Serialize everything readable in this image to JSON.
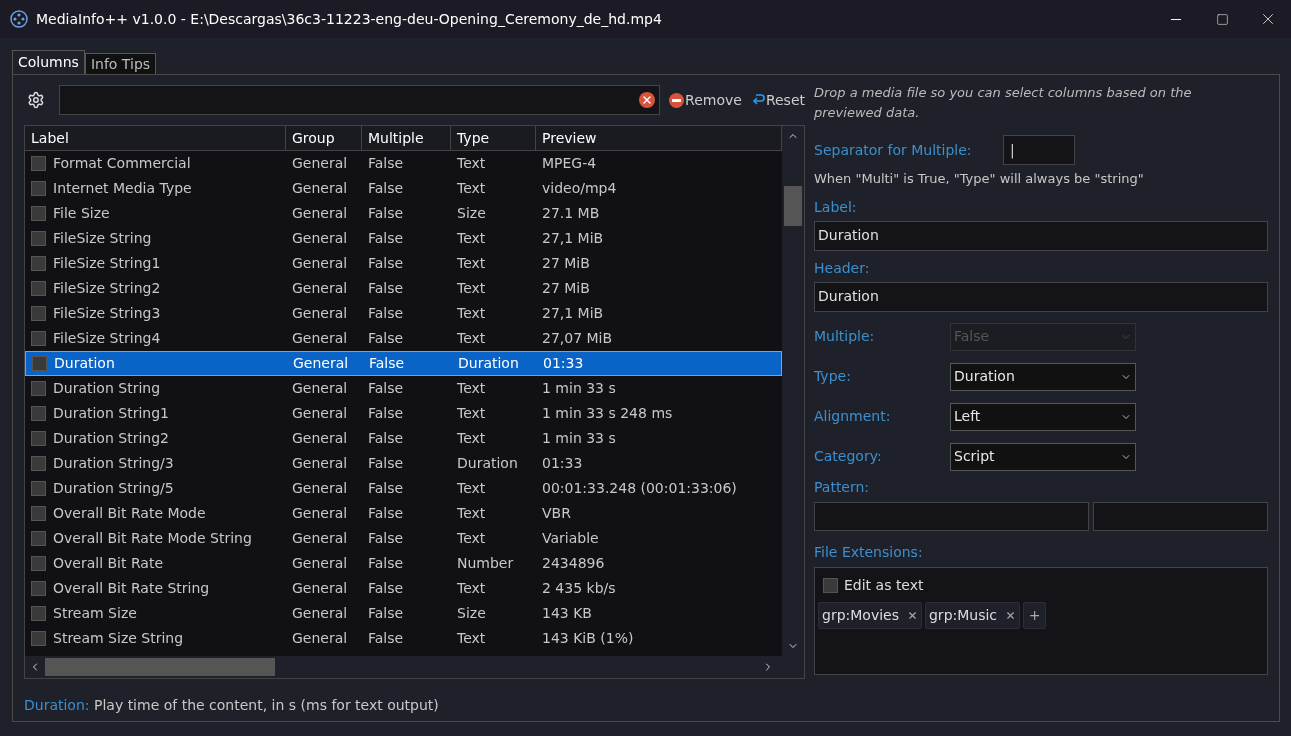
{
  "window": {
    "title": "MediaInfo++ v1.0.0 - E:\\Descargas\\36c3-11223-eng-deu-Opening_Ceremony_de_hd.mp4"
  },
  "tabs": [
    {
      "label": "Columns",
      "selected": true
    },
    {
      "label": "Info Tips",
      "selected": false
    }
  ],
  "toolbar": {
    "remove": "Remove",
    "reset": "Reset"
  },
  "table": {
    "columns": [
      "Label",
      "Group",
      "Multiple",
      "Type",
      "Preview"
    ],
    "rows": [
      {
        "label": "Format Commercial",
        "group": "General",
        "multiple": "False",
        "type": "Text",
        "preview": "MPEG-4",
        "checked": false,
        "selected": false
      },
      {
        "label": "Internet Media Type",
        "group": "General",
        "multiple": "False",
        "type": "Text",
        "preview": "video/mp4",
        "checked": false,
        "selected": false
      },
      {
        "label": "File Size",
        "group": "General",
        "multiple": "False",
        "type": "Size",
        "preview": "27.1 MB",
        "checked": false,
        "selected": false
      },
      {
        "label": "FileSize String",
        "group": "General",
        "multiple": "False",
        "type": "Text",
        "preview": "27,1 MiB",
        "checked": false,
        "selected": false
      },
      {
        "label": "FileSize String1",
        "group": "General",
        "multiple": "False",
        "type": "Text",
        "preview": "27 MiB",
        "checked": false,
        "selected": false
      },
      {
        "label": "FileSize String2",
        "group": "General",
        "multiple": "False",
        "type": "Text",
        "preview": "27 MiB",
        "checked": false,
        "selected": false
      },
      {
        "label": "FileSize String3",
        "group": "General",
        "multiple": "False",
        "type": "Text",
        "preview": "27,1 MiB",
        "checked": false,
        "selected": false
      },
      {
        "label": "FileSize String4",
        "group": "General",
        "multiple": "False",
        "type": "Text",
        "preview": "27,07 MiB",
        "checked": false,
        "selected": false
      },
      {
        "label": "Duration",
        "group": "General",
        "multiple": "False",
        "type": "Duration",
        "preview": "01:33",
        "checked": false,
        "selected": true
      },
      {
        "label": "Duration String",
        "group": "General",
        "multiple": "False",
        "type": "Text",
        "preview": "1 min 33 s",
        "checked": false,
        "selected": false
      },
      {
        "label": "Duration String1",
        "group": "General",
        "multiple": "False",
        "type": "Text",
        "preview": "1 min 33 s 248 ms",
        "checked": false,
        "selected": false
      },
      {
        "label": "Duration String2",
        "group": "General",
        "multiple": "False",
        "type": "Text",
        "preview": "1 min 33 s",
        "checked": false,
        "selected": false
      },
      {
        "label": "Duration String/3",
        "group": "General",
        "multiple": "False",
        "type": "Duration",
        "preview": "01:33",
        "checked": false,
        "selected": false
      },
      {
        "label": "Duration String/5",
        "group": "General",
        "multiple": "False",
        "type": "Text",
        "preview": "00:01:33.248 (00:01:33:06)",
        "checked": false,
        "selected": false
      },
      {
        "label": "Overall Bit Rate Mode",
        "group": "General",
        "multiple": "False",
        "type": "Text",
        "preview": "VBR",
        "checked": false,
        "selected": false
      },
      {
        "label": "Overall Bit Rate Mode String",
        "group": "General",
        "multiple": "False",
        "type": "Text",
        "preview": "Variable",
        "checked": false,
        "selected": false
      },
      {
        "label": "Overall Bit Rate",
        "group": "General",
        "multiple": "False",
        "type": "Number",
        "preview": "2434896",
        "checked": false,
        "selected": false
      },
      {
        "label": "Overall Bit Rate String",
        "group": "General",
        "multiple": "False",
        "type": "Text",
        "preview": "2 435 kb/s",
        "checked": false,
        "selected": false
      },
      {
        "label": "Stream Size",
        "group": "General",
        "multiple": "False",
        "type": "Size",
        "preview": "143 KB",
        "checked": false,
        "selected": false
      },
      {
        "label": "Stream Size String",
        "group": "General",
        "multiple": "False",
        "type": "Text",
        "preview": "143 KiB (1%)",
        "checked": false,
        "selected": false
      }
    ]
  },
  "status": {
    "label": "Duration:",
    "text": "Play time of the content, in s (ms for text output)"
  },
  "editor": {
    "hint": "Drop a media file so you can select columns based on the previewed data.",
    "separator_label": "Separator for Multiple:",
    "separator_value": "|",
    "note": "When \"Multi\" is True, \"Type\" will always be \"string\"",
    "label_label": "Label:",
    "label_value": "Duration",
    "header_label": "Header:",
    "header_value": "Duration",
    "selects": [
      {
        "label": "Multiple:",
        "value": "False",
        "disabled": true
      },
      {
        "label": "Type:",
        "value": "Duration",
        "disabled": false
      },
      {
        "label": "Alignment:",
        "value": "Left",
        "disabled": false
      },
      {
        "label": "Category:",
        "value": "Script",
        "disabled": false
      }
    ],
    "pattern_label": "Pattern:",
    "extensions_label": "File Extensions:",
    "edit_as_text": {
      "label": "Edit as text",
      "checked": false
    },
    "tags": [
      "grp:Movies",
      "grp:Music"
    ],
    "add": "+"
  }
}
